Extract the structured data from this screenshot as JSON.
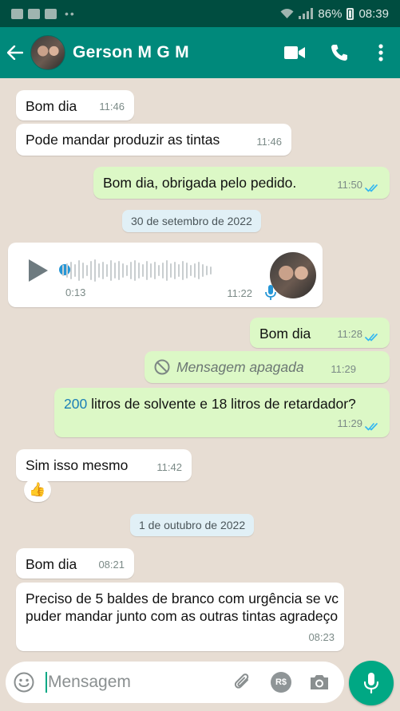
{
  "status_bar": {
    "battery": "86%",
    "time": "08:39"
  },
  "header": {
    "back_icon": "arrow-left",
    "contact_name": "Gerson M G M",
    "icons": [
      "video-call-icon",
      "phone-icon",
      "more-vert-icon"
    ]
  },
  "messages": [
    {
      "dir": "in",
      "text": "Bom dia",
      "time": "11:46"
    },
    {
      "dir": "in",
      "text": "Pode mandar produzir as tintas",
      "time": "11:46"
    },
    {
      "dir": "out",
      "text": "Bom dia, obrigada pelo pedido.",
      "time": "11:50",
      "read": true
    },
    {
      "type": "date",
      "text": "30 de setembro de 2022"
    },
    {
      "dir": "in",
      "type": "voice",
      "duration": "0:13",
      "time": "11:22"
    },
    {
      "dir": "out",
      "text": "Bom dia",
      "time": "11:28",
      "read": true
    },
    {
      "dir": "out",
      "type": "deleted",
      "text": "Mensagem apagada",
      "time": "11:29"
    },
    {
      "dir": "out",
      "text_highlight": "200",
      "text_rest": " litros de solvente e 18 litros de retardador?",
      "time": "11:29",
      "read": true
    },
    {
      "dir": "in",
      "text": "Sim isso mesmo",
      "time": "11:42",
      "reaction": "👍"
    },
    {
      "type": "date",
      "text": "1 de outubro de 2022"
    },
    {
      "dir": "in",
      "text": "Bom dia",
      "time": "08:21"
    },
    {
      "dir": "in",
      "text": "Preciso de 5 baldes de branco com urgência se vc puder mandar junto com as outras tintas agradeço",
      "time": "08:23"
    }
  ],
  "composer": {
    "placeholder": "Mensagem",
    "payment_label": "R$"
  },
  "colors": {
    "header": "#00897b",
    "status_bar": "#004d40",
    "outgoing": "#dcf8c6",
    "incoming": "#ffffff",
    "accent": "#00a884",
    "read_ticks": "#34b7f1"
  }
}
